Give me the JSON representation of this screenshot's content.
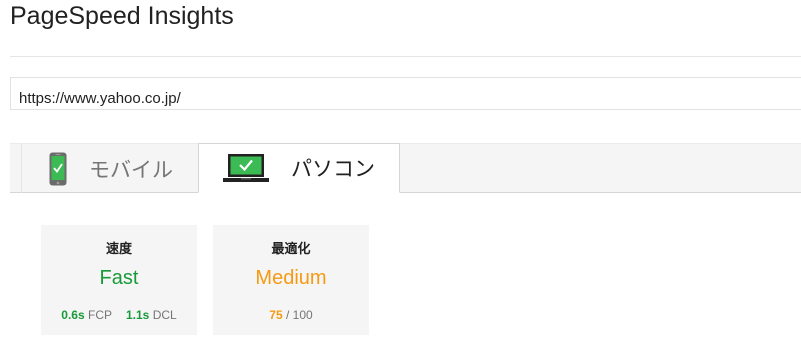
{
  "header": {
    "title": "PageSpeed Insights"
  },
  "url_input": {
    "value": "https://www.yahoo.co.jp/"
  },
  "tabs": [
    {
      "label": "モバイル",
      "icon": "phone-icon",
      "selected": false
    },
    {
      "label": "パソコン",
      "icon": "laptop-icon",
      "selected": true
    }
  ],
  "cards": {
    "speed": {
      "heading": "速度",
      "rating": "Fast",
      "fcp_value": "0.6s",
      "fcp_label": "FCP",
      "dcl_value": "1.1s",
      "dcl_label": "DCL"
    },
    "optimization": {
      "heading": "最適化",
      "rating": "Medium",
      "score": "75",
      "score_suffix": "/ 100"
    }
  },
  "colors": {
    "fast": "#189a3a",
    "medium": "#f59a12",
    "icon_green": "#3cba54"
  }
}
